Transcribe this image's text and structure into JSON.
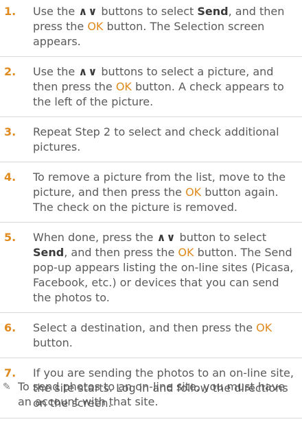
{
  "keywords": {
    "arrows": "∧∨",
    "send": "Send",
    "ok": "OK"
  },
  "steps": [
    {
      "num": "1.",
      "t1": "Use the ",
      "t2": " buttons to select ",
      "t3": ", and then press the ",
      "t4": " button. The Selection screen appears."
    },
    {
      "num": "2.",
      "t1": "Use the ",
      "t2": " buttons to select a picture, and then press the ",
      "t3": " button. A check appears to the left of the picture."
    },
    {
      "num": "3.",
      "t1": "Repeat Step 2 to select and check additional pictures."
    },
    {
      "num": "4.",
      "t1": "To remove a picture from the list, move to the picture, and then press the ",
      "t2": " button again. The check on the picture is removed."
    },
    {
      "num": "5.",
      "t1": "When done, press the ",
      "t2": " button to select ",
      "t3": ", and then press the ",
      "t4": " button. The Send pop-up appears listing the on-line sites (Picasa, Facebook, etc.) or devices that you can send the photos to."
    },
    {
      "num": "6.",
      "t1": "Select a destination, and then press the ",
      "t2": " button."
    },
    {
      "num": "7.",
      "t1": "If you are sending the photos to an on-line site, the site starts. Log in and follow the directions on the screen."
    }
  ],
  "note": {
    "icon": "pencil-note-icon",
    "text": "To send photos to an on-line site, you must have an account with that site."
  },
  "colors": {
    "accent": "#e08a1e",
    "text": "#5a5a5a",
    "divider": "#d8d8d8"
  }
}
